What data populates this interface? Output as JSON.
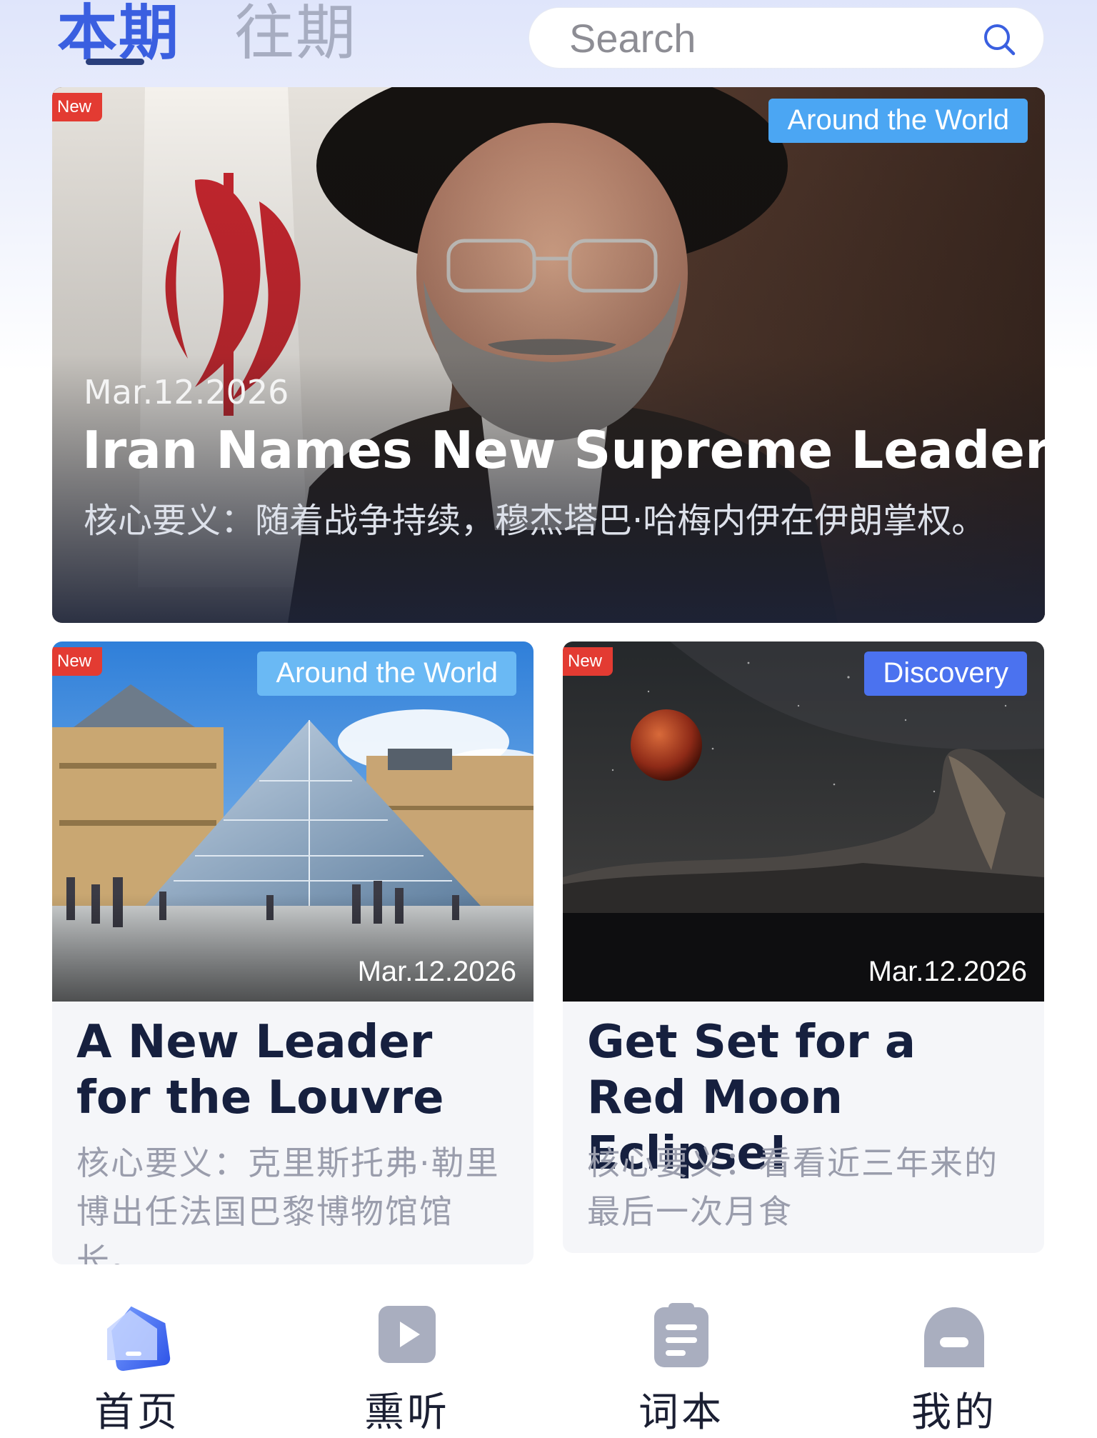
{
  "header": {
    "tabs": [
      {
        "label": "本期",
        "active": true
      },
      {
        "label": "往期",
        "active": false
      }
    ],
    "search": {
      "placeholder": "Search",
      "icon": "search-icon"
    }
  },
  "colors": {
    "accent": "#3a5fe0",
    "new_badge": "#e33b32",
    "category_world": "#4ba6f3",
    "category_discovery": "#4b72ef"
  },
  "featured": {
    "badge": "New",
    "category": "Around the World",
    "date": "Mar.12.2026",
    "title": "Iran Names New Supreme Leader",
    "summary": "核心要义：随着战争持续，穆杰塔巴·哈梅内伊在伊朗掌权。"
  },
  "articles": [
    {
      "badge": "New",
      "category": "Around the World",
      "date": "Mar.12.2026",
      "title": "A New Leader for the Louvre",
      "summary": "核心要义：克里斯托弗·勒里博出任法国巴黎博物馆馆长。"
    },
    {
      "badge": "New",
      "category": "Discovery",
      "date": "Mar.12.2026",
      "title": "Get Set for a Red Moon Eclipse!",
      "summary": "核心要义：看看近三年来的最后一次月食"
    }
  ],
  "bottom_nav": [
    {
      "label": "首页",
      "icon": "home-icon",
      "active": true
    },
    {
      "label": "熏听",
      "icon": "play-icon",
      "active": false
    },
    {
      "label": "词本",
      "icon": "notebook-icon",
      "active": false
    },
    {
      "label": "我的",
      "icon": "profile-icon",
      "active": false
    }
  ]
}
